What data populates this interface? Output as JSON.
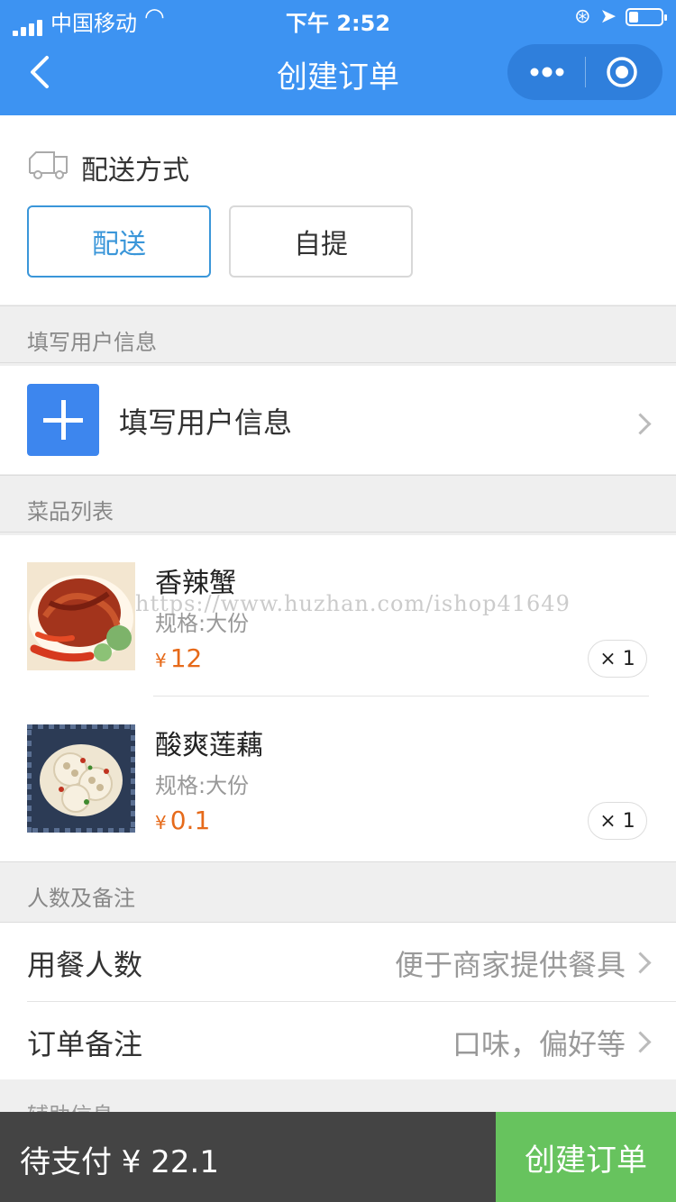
{
  "status_bar": {
    "carrier": "中国移动",
    "time": "下午 2:52"
  },
  "nav": {
    "title": "创建订单"
  },
  "delivery": {
    "title": "配送方式",
    "options": [
      "配送",
      "自提"
    ],
    "selected": "配送"
  },
  "user_section": {
    "header": "填写用户信息",
    "action_label": "填写用户信息"
  },
  "dish_section": {
    "header": "菜品列表",
    "items": [
      {
        "name": "香辣蟹",
        "spec": "规格:大份",
        "currency": "¥",
        "price": "12",
        "qty": "× 1"
      },
      {
        "name": "酸爽莲藕",
        "spec": "规格:大份",
        "currency": "¥",
        "price": "0.1",
        "qty": "× 1"
      }
    ]
  },
  "watermark": "https://www.huzhan.com/ishop41649",
  "notes_section": {
    "header": "人数及备注",
    "rows": [
      {
        "label": "用餐人数",
        "placeholder": "便于商家提供餐具"
      },
      {
        "label": "订单备注",
        "placeholder": "口味，偏好等"
      }
    ]
  },
  "next_section_header": "辅助信息",
  "bottom_bar": {
    "pay_label": "待支付 ¥ 22.1",
    "create_label": "创建订单"
  },
  "colors": {
    "nav": "#3d93f2",
    "accent_border": "#3a96d9",
    "price": "#e66a1a",
    "create_button": "#67c35e",
    "bottom_bar": "#444444"
  }
}
